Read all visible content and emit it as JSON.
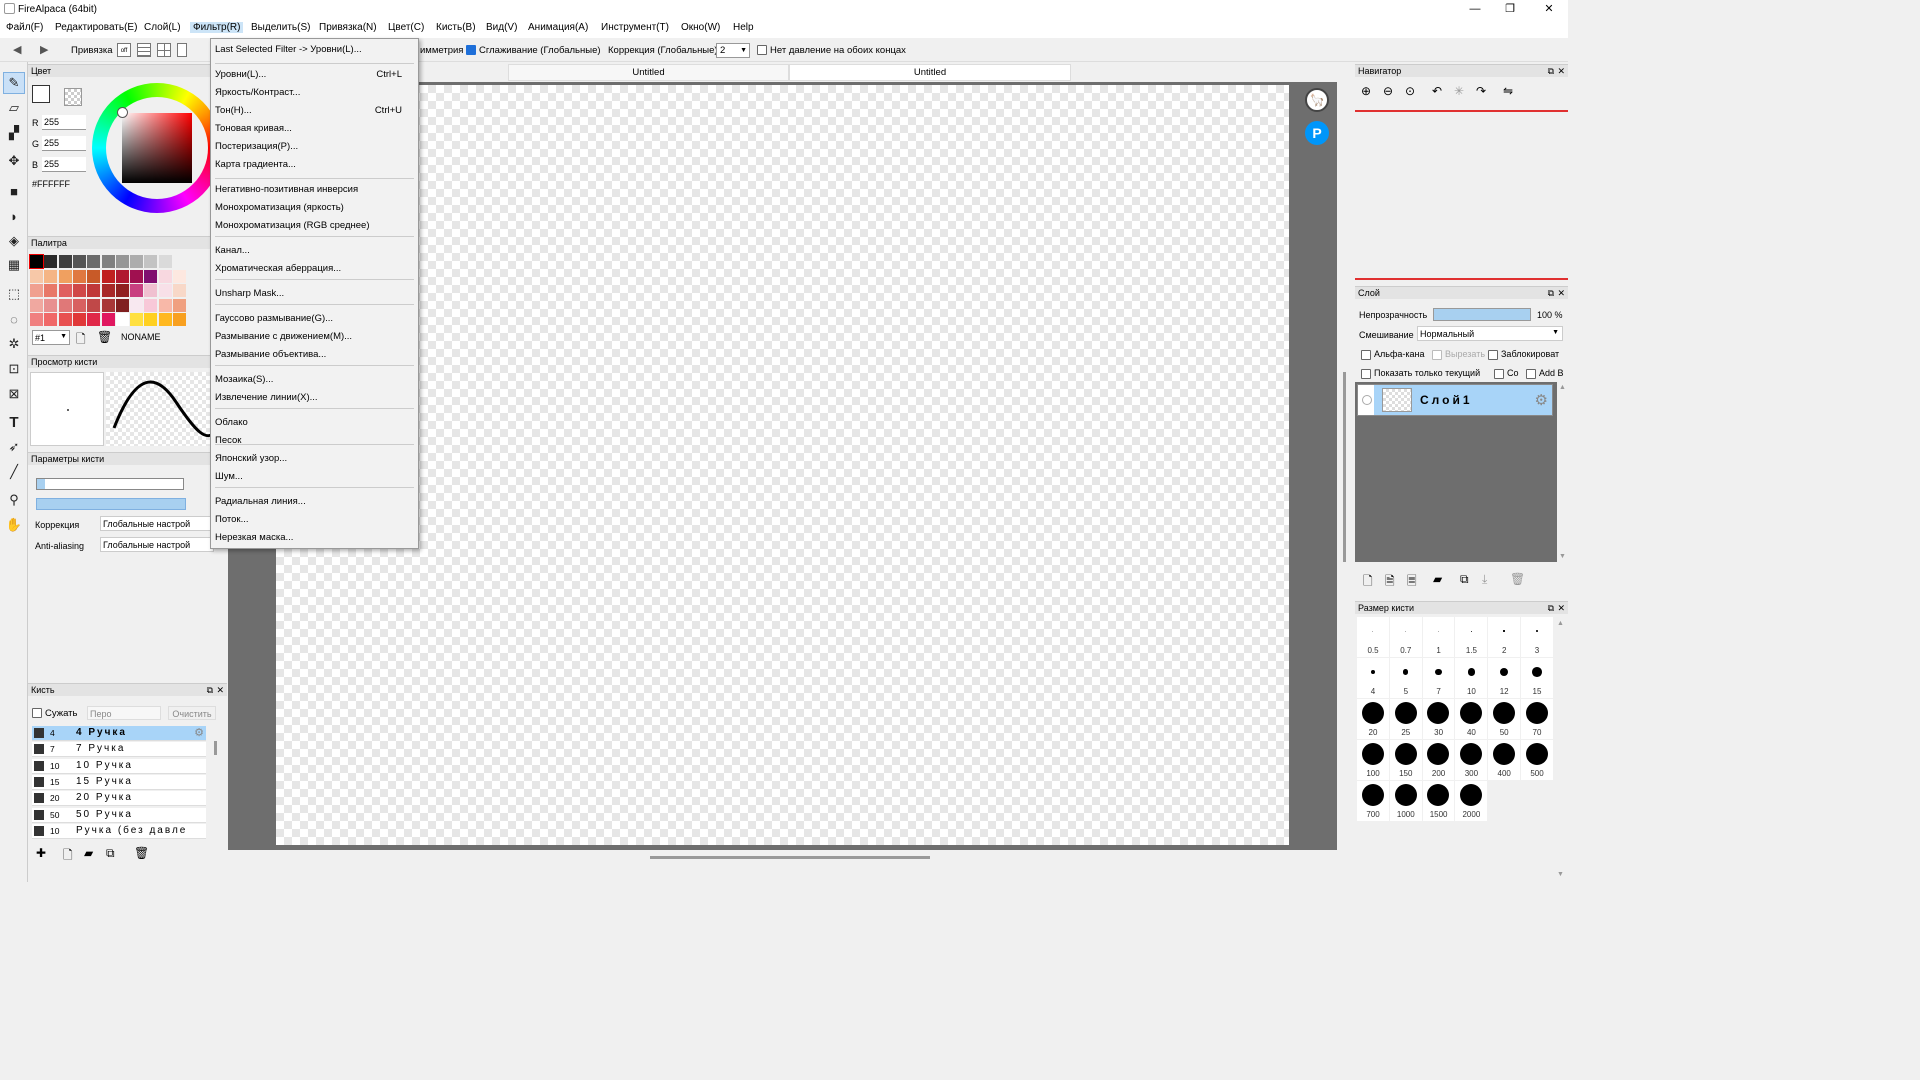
{
  "app": {
    "title": "FireAlpaca (64bit)",
    "minimize": "—",
    "restore": "❐",
    "close": "✕"
  },
  "menu": [
    "Файл(F)",
    "Редактировать(E)",
    "Слой(L)",
    "Фильтр(R)",
    "Выделить(S)",
    "Привязка(N)",
    "Цвет(C)",
    "Кисть(B)",
    "Вид(V)",
    "Анимация(A)",
    "Инструмент(T)",
    "Окно(W)",
    "Help"
  ],
  "toolbar": {
    "snap": "Привязка",
    "snap_off": "off",
    "symmetry": "имметрия",
    "smoothing": "Сглаживание (Глобальные)",
    "correction": "Коррекция (Глобальные)",
    "correction_value": "2",
    "no_pressure": "Нет давление на обоих концах"
  },
  "tabs": [
    "Untitled",
    "Untitled"
  ],
  "filter_menu": {
    "items": [
      {
        "label": "Last Selected Filter -> Уровни(L)...",
        "shortcut": ""
      },
      {
        "label": "Уровни(L)...",
        "shortcut": "Ctrl+L"
      },
      {
        "label": "Яркость/Контраст...",
        "shortcut": ""
      },
      {
        "label": "Тон(H)...",
        "shortcut": "Ctrl+U"
      },
      {
        "label": "Тоновая кривая...",
        "shortcut": ""
      },
      {
        "label": "Постеризация(P)...",
        "shortcut": ""
      },
      {
        "label": "Карта градиента...",
        "shortcut": ""
      },
      {
        "label": "Негативно-позитивная инверсия",
        "shortcut": ""
      },
      {
        "label": "Монохроматизация (яркость)",
        "shortcut": ""
      },
      {
        "label": "Монохроматизация (RGB среднее)",
        "shortcut": ""
      },
      {
        "label": "Канал...",
        "shortcut": ""
      },
      {
        "label": "Хроматическая аберрация...",
        "shortcut": ""
      },
      {
        "label": "Unsharp Mask...",
        "shortcut": ""
      },
      {
        "label": "Гауссово размывание(G)...",
        "shortcut": ""
      },
      {
        "label": "Размывание с движением(M)...",
        "shortcut": ""
      },
      {
        "label": "Размывание объектива...",
        "shortcut": ""
      },
      {
        "label": "Мозаика(S)...",
        "shortcut": ""
      },
      {
        "label": "Извлечение линии(X)...",
        "shortcut": ""
      },
      {
        "label": "Облако",
        "shortcut": ""
      },
      {
        "label": "Песок",
        "shortcut": ""
      },
      {
        "label": "Японский узор...",
        "shortcut": ""
      },
      {
        "label": "Шум...",
        "shortcut": ""
      },
      {
        "label": "Радиальная линия...",
        "shortcut": ""
      },
      {
        "label": "Поток...",
        "shortcut": ""
      },
      {
        "label": "Нерезкая маска...",
        "shortcut": ""
      }
    ]
  },
  "color_panel": {
    "title": "Цвет",
    "r_label": "R",
    "g_label": "G",
    "b_label": "B",
    "r": "255",
    "g": "255",
    "b": "255",
    "hex": "#FFFFFF"
  },
  "palette_panel": {
    "title": "Палитра",
    "index": "#1",
    "name": "NONAME",
    "swatches": [
      "#000000",
      "#2a2a2a",
      "#3f3f3f",
      "#555555",
      "#6b6b6b",
      "#808080",
      "#969696",
      "#adadad",
      "#c3c3c3",
      "#dadada",
      "#f0f0f0",
      "#f7c8a8",
      "#f5b585",
      "#f0a060",
      "#e07840",
      "#c85a28",
      "#c02020",
      "#b01830",
      "#a01050",
      "#801070",
      "#f8d8e0",
      "#fde8e0",
      "#f0a090",
      "#e87868",
      "#e06060",
      "#d04848",
      "#c03838",
      "#a82828",
      "#902020",
      "#c84080",
      "#f0c0d0",
      "#f8e0e8",
      "#f8d8c8",
      "#f0a8a0",
      "#e89090",
      "#e07878",
      "#d86060",
      "#c04848",
      "#a83838",
      "#802020",
      "#f8e8f0",
      "#f8c8d8",
      "#f8b8a8",
      "#f0a080",
      "#f08080",
      "#f06868",
      "#e85050",
      "#e03838",
      "#e02848",
      "#e01860",
      "#ffffff",
      "#ffe040",
      "#ffd020",
      "#ffb820",
      "#f8a020"
    ]
  },
  "brush_preview": {
    "title": "Просмотр кисти"
  },
  "brush_params": {
    "title": "Параметры кисти",
    "correction_label": "Коррекция",
    "correction_value": "Глобальные настрой",
    "aa_label": "Anti-aliasing",
    "aa_value": "Глобальные настрой"
  },
  "brush_panel": {
    "title": "Кисть",
    "narrow": "Сужать",
    "search_placeholder": "Перо",
    "clear": "Очистить",
    "items": [
      {
        "size": "4",
        "name": "4 Ручка"
      },
      {
        "size": "7",
        "name": "7 Ручка"
      },
      {
        "size": "10",
        "name": "10 Ручка"
      },
      {
        "size": "15",
        "name": "15 Ручка"
      },
      {
        "size": "20",
        "name": "20 Ручка"
      },
      {
        "size": "50",
        "name": "50 Ручка"
      },
      {
        "size": "10",
        "name": "Ручка (без давле"
      }
    ]
  },
  "navigator": {
    "title": "Навигатор"
  },
  "layer_panel": {
    "title": "Слой",
    "opacity_label": "Непрозрачность",
    "opacity_value": "100 %",
    "opacity_fraction": 1.0,
    "blend_label": "Смешивание",
    "blend_value": "Нормальный",
    "alpha": "Альфа-кана",
    "clip": "Вырезать",
    "lock": "Заблокироват",
    "show_current": "Показать только текущий",
    "co": "Со",
    "addb": "Add B",
    "layer_name": "Слой1"
  },
  "brush_size": {
    "title": "Размер кисти",
    "sizes": [
      "0.5",
      "0.7",
      "1",
      "1.5",
      "2",
      "3",
      "4",
      "5",
      "7",
      "10",
      "12",
      "15",
      "20",
      "25",
      "30",
      "40",
      "50",
      "70",
      "100",
      "150",
      "200",
      "300",
      "400",
      "500",
      "700",
      "1000",
      "1500",
      "2000"
    ]
  }
}
